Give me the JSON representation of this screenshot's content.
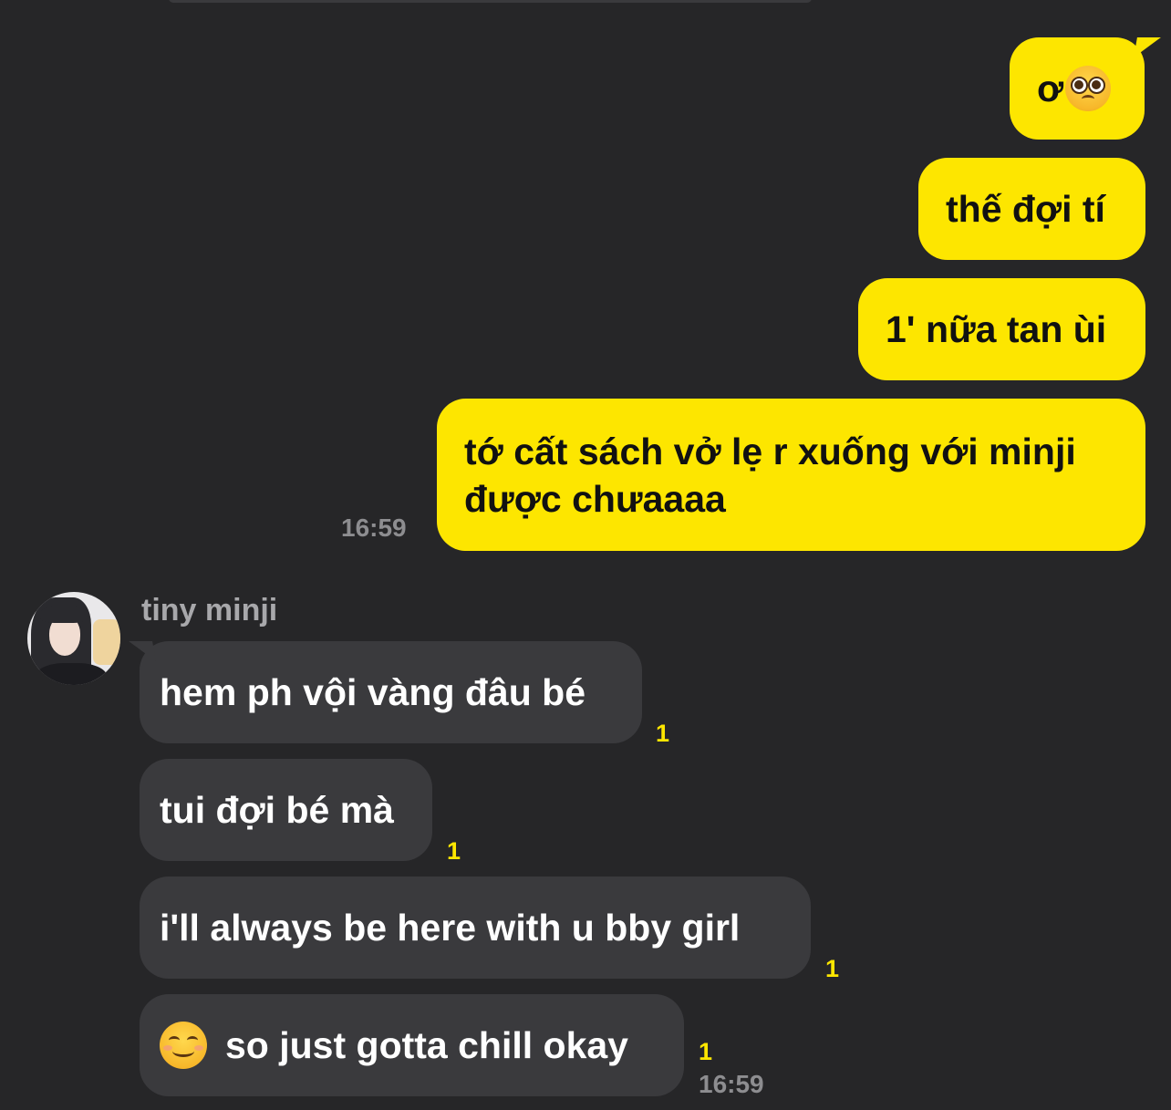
{
  "outgoing": [
    {
      "text": "ơ",
      "emoji": "pleading-face-emoji"
    },
    {
      "text": "thế đợi tí"
    },
    {
      "text": "1' nữa tan ùi"
    },
    {
      "line1": "tớ cất sách vở lẹ r xuống với minji",
      "line2": "được chưaaaa"
    }
  ],
  "outgoing_time": "16:59",
  "sender": {
    "name": "tiny minji"
  },
  "incoming": [
    {
      "text": "hem ph vội vàng đâu bé",
      "unread": "1"
    },
    {
      "text": "tui đợi bé mà",
      "unread": "1"
    },
    {
      "text": "i'll always be here with u bby girl",
      "unread": "1"
    },
    {
      "text": "so just gotta chill okay",
      "emoji": "smiling-face-emoji",
      "unread": "1"
    }
  ],
  "incoming_time": "16:59",
  "colors": {
    "background": "#262628",
    "outgoing_bubble": "#fde600",
    "incoming_bubble": "#3a3a3d",
    "unread_count": "#fde600"
  }
}
